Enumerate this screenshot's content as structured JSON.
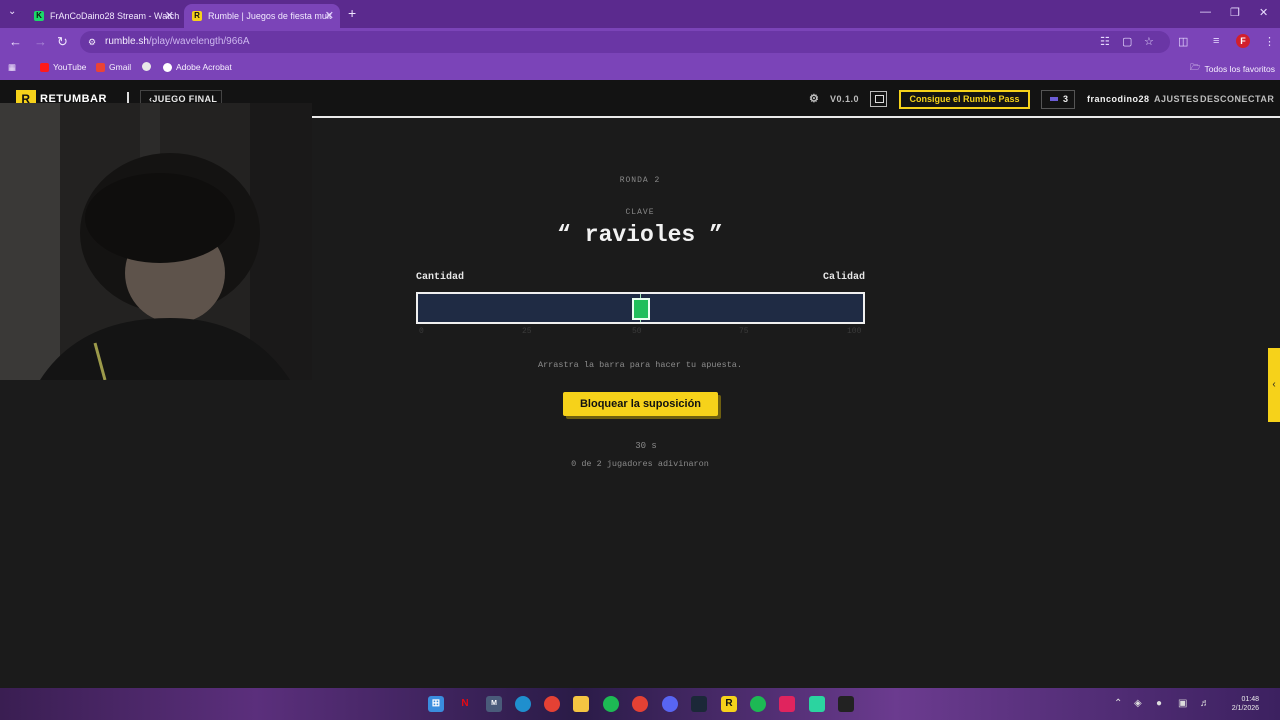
{
  "browser": {
    "tabs": [
      {
        "title": "FrAnCoDaino28 Stream - Watch",
        "favicon_color": "#1bd96a",
        "favicon": "K"
      },
      {
        "title": "Rumble | Juegos de fiesta mult",
        "favicon_color": "#f6d21a",
        "favicon": "R"
      }
    ],
    "url_host": "rumble.sh",
    "url_path": "/play/wavelength/966A",
    "bookmarks": [
      "YouTube",
      "Gmail",
      "Adobe Acrobat"
    ],
    "all_bookmarks": "Todos los favoritos",
    "profile_initial": "F"
  },
  "app": {
    "logo_letter": "R",
    "logo_text": "RETUMBAR",
    "back_label": "‹JUEGO FINAL",
    "version": "V0.1.0",
    "pass_button": "Consigue el Rumble Pass",
    "coins": "3",
    "username": "francodino28",
    "settings": "AJUSTES",
    "logout": "DESCONECTAR"
  },
  "game": {
    "round": "RONDA 2",
    "clue_label": "CLAVE",
    "clue": "“ ravioles ”",
    "left_label": "Cantidad",
    "right_label": "Calidad",
    "scale_ticks": [
      "0",
      "25",
      "50",
      "75",
      "100"
    ],
    "guess_value": 50,
    "hint": "Arrastra la barra para hacer tu apuesta.",
    "lock_button": "Bloquear la suposición",
    "timer": "30 s",
    "players": "0 de 2 jugadores adivinaron"
  },
  "taskbar": {
    "time": "01:48",
    "date": "2/1/2026"
  },
  "colors": {
    "accent": "#f6d21a",
    "browser_purple": "#7b44b8",
    "slider_fill": "#1f2b44",
    "thumb": "#1fbf5b"
  }
}
